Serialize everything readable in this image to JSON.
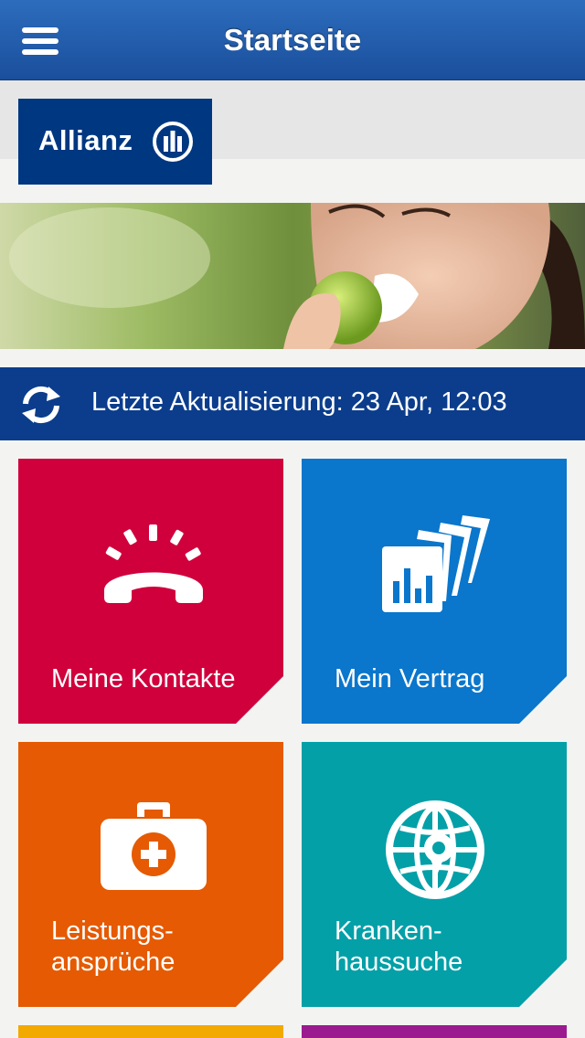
{
  "navbar": {
    "title": "Startseite"
  },
  "brand": {
    "logo_text": "Allianz"
  },
  "update": {
    "text": "Letzte Aktualisierung: 23 Apr, 12:03"
  },
  "tiles": [
    {
      "label": "Meine Kontakte",
      "color": "#d0003c",
      "icon": "phone-icon"
    },
    {
      "label": "Mein Vertrag",
      "color": "#0a76cc",
      "icon": "contract-chart-icon"
    },
    {
      "label_line1": "Leistungs-",
      "label_line2": "ansprüche",
      "color": "#e55a02",
      "icon": "first-aid-kit-icon"
    },
    {
      "label_line1": "Kranken-",
      "label_line2": "haussuche",
      "color": "#03a0a8",
      "icon": "globe-location-icon"
    },
    {
      "color": "#f2a900"
    },
    {
      "color": "#9b1a8f"
    }
  ]
}
